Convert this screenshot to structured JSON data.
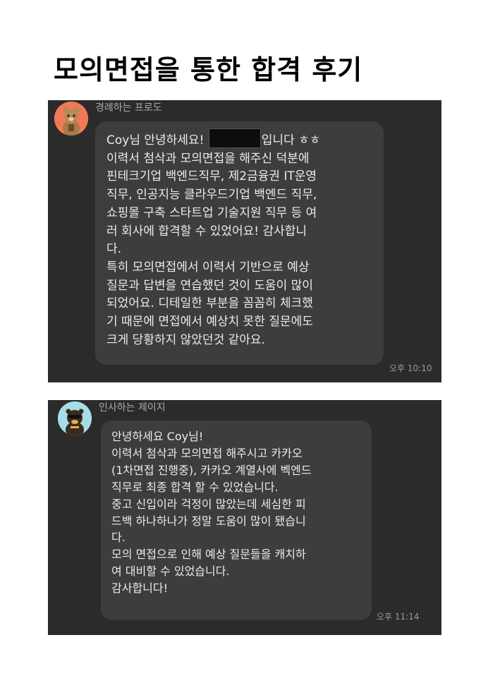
{
  "page": {
    "title": "모의면접을 통한 합격 후기"
  },
  "chats": [
    {
      "sender": "경례하는 프로도",
      "avatar": "frodo-saluting-avatar",
      "line1_before": "Coy님 안녕하세요! ",
      "line1_after": "입니다 ㅎㅎ",
      "lines": [
        "이력서 첨삭과 모의면접을 해주신 덕분에",
        "핀테크기업 백엔드직무, 제2금융권 IT운영",
        "직무, 인공지능 클라우드기업 백엔드 직무,",
        "쇼핑몰 구축 스타트업 기술지원 직무 등 여",
        "러 회사에 합격할 수 있었어요! 감사합니",
        "다.",
        "특히 모의면접에서 이력서 기반으로 예상",
        "질문과 답변을 연습했던 것이 도움이 많이",
        "되었어요. 디테일한 부분을 꼼꼼히 체크했",
        "기 때문에 면접에서 예상치 못한 질문에도",
        "크게 당황하지 않았던것 같아요."
      ],
      "time": "오후 10:10"
    },
    {
      "sender": "인사하는 제이지",
      "avatar": "jay-g-bowing-avatar",
      "lines": [
        "안녕하세요 Coy님!",
        "이력서 첨삭과 모의면접 해주시고 카카오",
        "(1차면접 진행중), 카카오 계열사에 벡엔드",
        "직무로 최종 합격 할 수 있었습니다.",
        "중고 신입이라 걱정이 많았는데 세심한 피",
        "드백 하나하나가 정말 도움이 많이 됐습니",
        "다.",
        "모의 면접으로 인해 예상 질문들을 캐치하",
        "여 대비할 수 있었습니다.",
        "감사합니다!"
      ],
      "time": "오후 11:14"
    }
  ],
  "colors": {
    "chat_background": "#2b2b2b",
    "bubble_background": "#3d3d3d",
    "bubble_text": "#ebebeb",
    "meta_text": "#a9a9a9"
  }
}
